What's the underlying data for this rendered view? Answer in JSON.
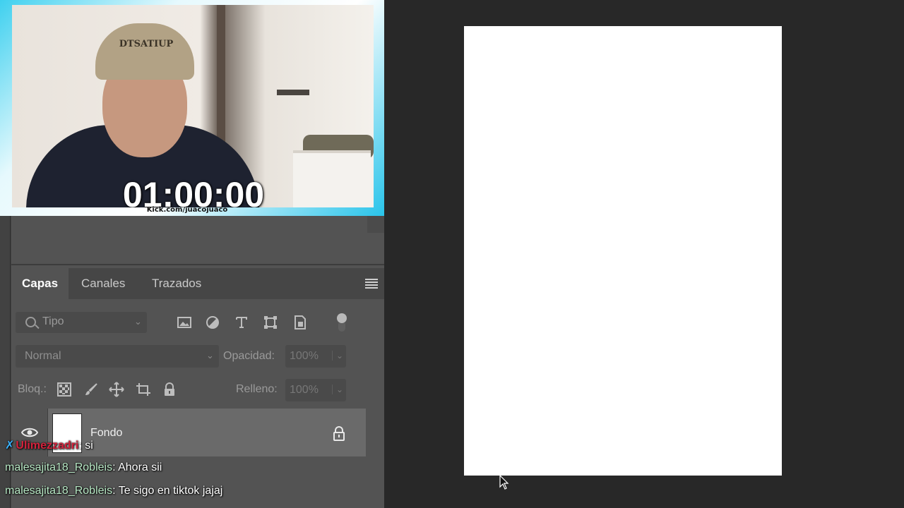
{
  "stream": {
    "timer": "01:00:00",
    "url": "Kick.com/juacojuaco",
    "cap_text": "DTSATIUP"
  },
  "layers_panel": {
    "tabs": [
      {
        "label": "Capas",
        "active": true
      },
      {
        "label": "Canales",
        "active": false
      },
      {
        "label": "Trazados",
        "active": false
      }
    ],
    "filter": {
      "label": "Tipo"
    },
    "filter_icons": [
      "image-filter-icon",
      "adjustment-filter-icon",
      "text-filter-icon",
      "shape-filter-icon",
      "smart-object-filter-icon"
    ],
    "blend_mode": "Normal",
    "opacity_label": "Opacidad:",
    "opacity_value": "100%",
    "lock_label": "Bloq.:",
    "fill_label": "Relleno:",
    "fill_value": "100%",
    "layers": [
      {
        "name": "Fondo",
        "visible": true,
        "locked": true
      }
    ]
  },
  "chat": [
    {
      "user": "Ulimezzadri",
      "message": "si",
      "badge": "moderator",
      "color": "#d4223c"
    },
    {
      "user": "malesajita18_Robleis",
      "message": "Ahora sii",
      "color": "#b7e7c4"
    },
    {
      "user": "malesajita18_Robleis",
      "message": "Te sigo en tiktok jajaj",
      "color": "#b7e7c4"
    }
  ],
  "colors": {
    "workspace": "#282828",
    "panel": "#535353",
    "canvas": "#ffffff",
    "overlay_accent": "#29c4ea"
  }
}
